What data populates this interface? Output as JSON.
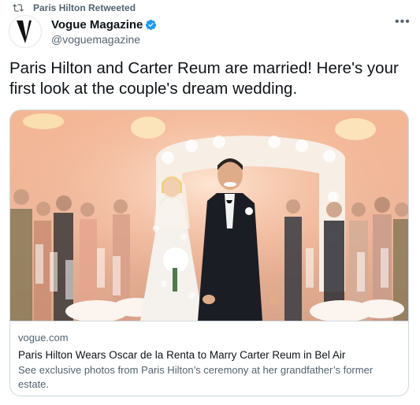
{
  "retweet": {
    "label": "Paris Hilton Retweeted"
  },
  "author": {
    "name": "Vogue Magazine",
    "handle": "@voguemagazine",
    "verified": true,
    "avatar_letter": "V"
  },
  "tweet": {
    "text": "Paris Hilton and Carter Reum are married! Here's your first look at the couple's dream wedding."
  },
  "card": {
    "domain": "vogue.com",
    "headline": "Paris Hilton Wears Oscar de la Renta to Marry Carter Reum in Bel Air",
    "description": "See exclusive photos from Paris Hilton’s ceremony at her grandfather’s former estate."
  },
  "icons": {
    "retweet": "retweet-icon",
    "verified": "verified-badge-icon",
    "more": "more-options-icon"
  },
  "colors": {
    "verified": "#1d9bf0",
    "secondary_text": "#536471",
    "border": "#cfd9de"
  }
}
